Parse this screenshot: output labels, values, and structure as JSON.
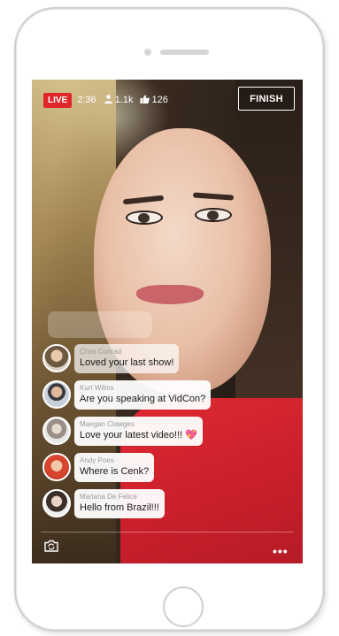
{
  "stream": {
    "live_label": "LIVE",
    "duration": "2:36",
    "viewers": "1.1k",
    "likes": "126",
    "finish_label": "FINISH"
  },
  "comments": [
    {
      "name": "Chris Conrad",
      "text": "Loved your last show!"
    },
    {
      "name": "Kurt Wilms",
      "text": "Are you speaking at VidCon?"
    },
    {
      "name": "Maegan Clawges",
      "text": "Love your latest video!!!",
      "emoji": "💖"
    },
    {
      "name": "Andy Poes",
      "text": "Where is Cenk?"
    },
    {
      "name": "Mariana De Felice",
      "text": "Hello from Brazil!!!"
    }
  ],
  "controls": {
    "more_label": "•••",
    "camera_icon": "camera-switch-icon"
  },
  "colors": {
    "live_red": "#e0262b",
    "shirt_red": "#d42430"
  }
}
